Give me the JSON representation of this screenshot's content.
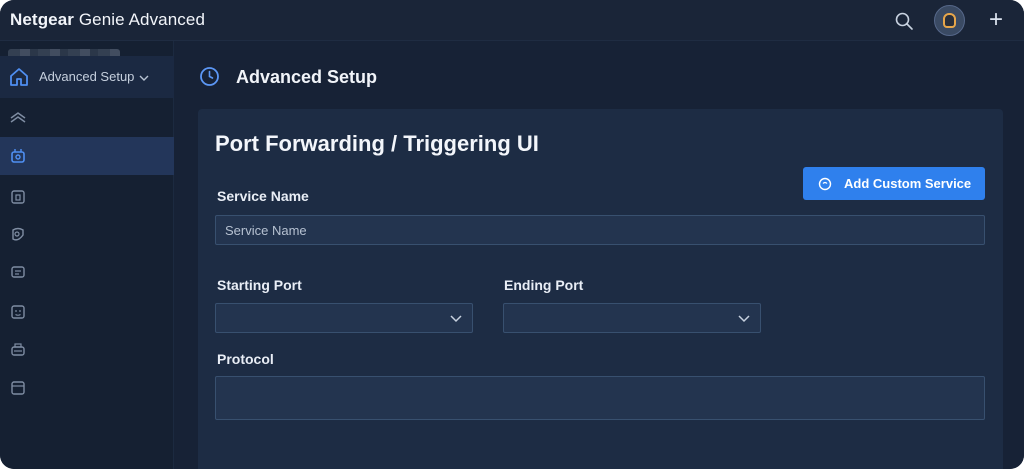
{
  "app": {
    "title_bold": "Netgear",
    "title_rest": " Genie Advanced"
  },
  "topbar": {
    "icons": [
      "search-icon",
      "avatar",
      "plus-icon"
    ],
    "plus_glyph": "+"
  },
  "sidebar": {
    "header_label": "Advanced Setup",
    "items": [
      {
        "icon": "layers-icon",
        "active": false
      },
      {
        "icon": "router-icon",
        "active": true
      },
      {
        "icon": "device-icon",
        "active": false
      },
      {
        "icon": "shield-icon",
        "active": false
      },
      {
        "icon": "chat-icon",
        "active": false
      },
      {
        "icon": "face-icon",
        "active": false
      },
      {
        "icon": "printer-icon",
        "active": false
      },
      {
        "icon": "window-icon",
        "active": false
      }
    ]
  },
  "main": {
    "page_title": "Advanced Setup",
    "card_title": "Port Forwarding / Triggering UI",
    "add_button_label": "Add Custom Service",
    "service_name_label": "Service Name",
    "service_name_placeholder": "Service Name",
    "service_name_value": "",
    "starting_port_label": "Starting Port",
    "starting_port_value": "",
    "ending_port_label": "Ending Port",
    "ending_port_value": "",
    "protocol_label": "Protocol",
    "protocol_value": ""
  },
  "colors": {
    "background": "#172236",
    "sidebar": "#152032",
    "card": "#1d2c44",
    "accent": "#2f80ed",
    "active_item": "#23365a"
  }
}
